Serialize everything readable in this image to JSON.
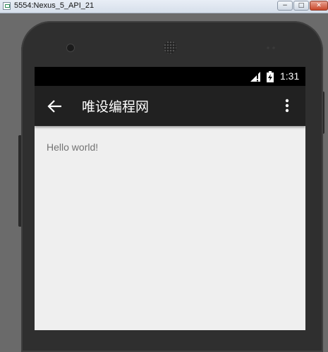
{
  "window": {
    "title": "5554:Nexus_5_API_21",
    "minimize_label": "−",
    "maximize_label": "□",
    "close_label": "✕"
  },
  "statusbar": {
    "time": "1:31",
    "icons": [
      "signal-icon",
      "battery-icon"
    ]
  },
  "appbar": {
    "title": "唯设编程网",
    "back_icon": "arrow-left-icon",
    "menu_icon": "more-vert-icon"
  },
  "content": {
    "text": "Hello world!"
  },
  "colors": {
    "appbar": "#212121",
    "statusbar": "#000000",
    "screen_bg": "#efefef",
    "content_text": "#737373"
  }
}
